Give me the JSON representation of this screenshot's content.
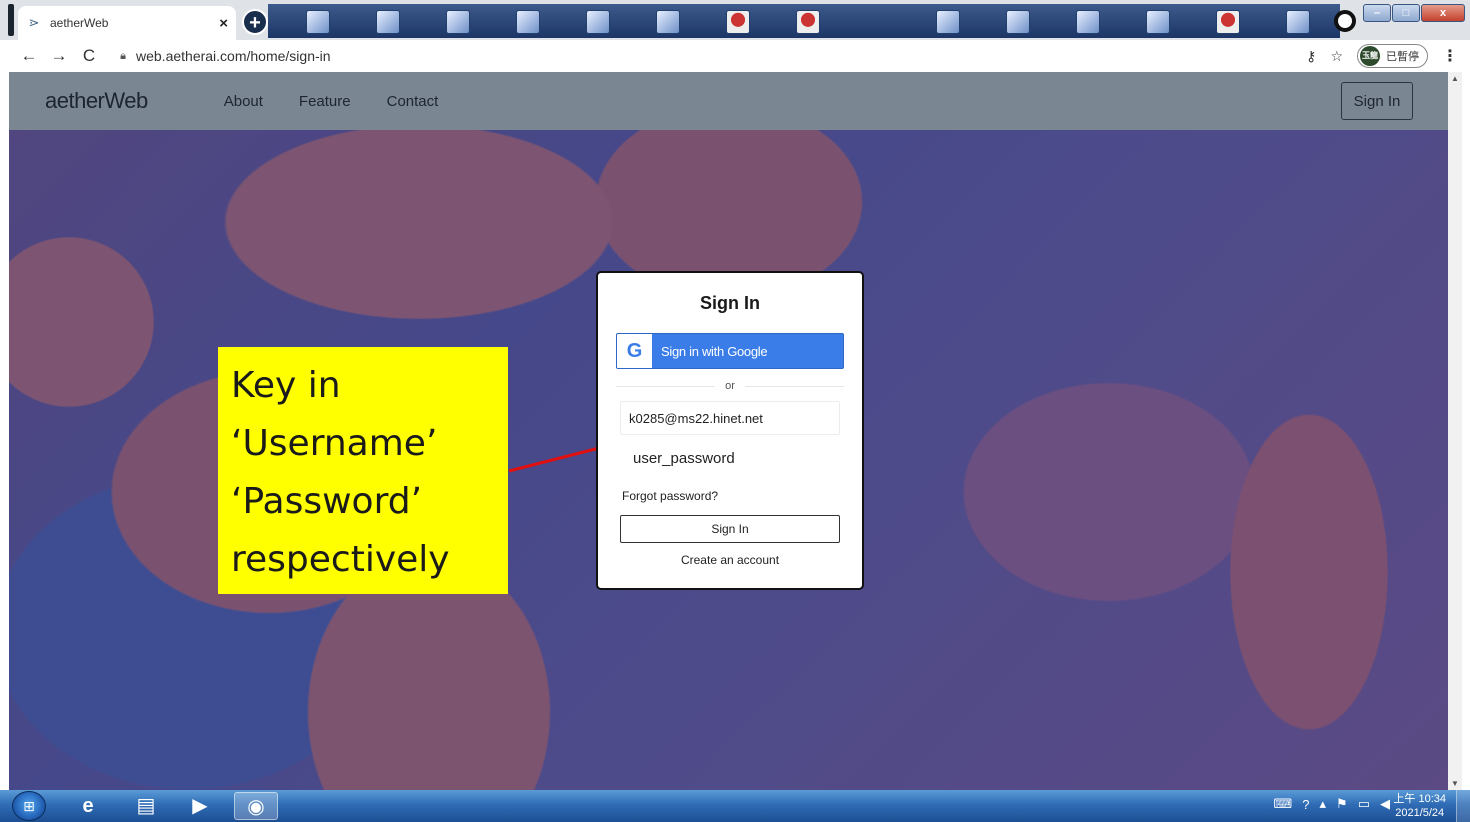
{
  "browser": {
    "tab_title": "aetherWeb",
    "tab_close": "×",
    "new_tab": "+",
    "url": "web.aetherai.com/home/sign-in",
    "profile_badge": "玉龍",
    "profile_status": "已暫停"
  },
  "site": {
    "logo": "aetherWeb",
    "nav": [
      "About",
      "Feature",
      "Contact"
    ],
    "sign_in_button": "Sign In"
  },
  "card": {
    "title": "Sign In",
    "google_label": "Sign in with Google",
    "google_glyph": "G",
    "divider": "or",
    "username_value": "k0285@ms22.hinet.net",
    "password_value": "user_password",
    "forgot": "Forgot password?",
    "submit": "Sign In",
    "create": "Create an account"
  },
  "callout": {
    "lines": [
      "Key in",
      "‘Username’",
      "‘Password’",
      "respectively"
    ],
    "color": "#ffff00",
    "arrow_color": "#e01010"
  },
  "taskbar": {
    "time": "上午 10:34",
    "date": "2021/5/24"
  }
}
